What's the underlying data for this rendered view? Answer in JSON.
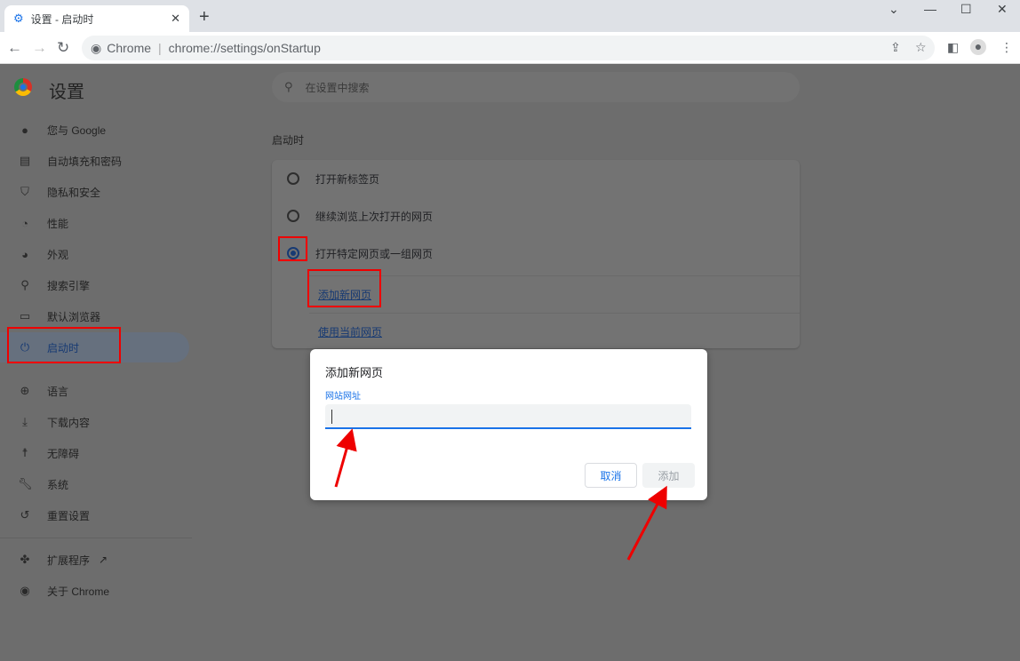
{
  "browser": {
    "tab_title": "设置 - 启动时",
    "omnibox_label": "Chrome",
    "url": "chrome://settings/onStartup"
  },
  "header": {
    "title": "设置",
    "search_placeholder": "在设置中搜索"
  },
  "sidebar": {
    "items": [
      {
        "label": "您与 Google",
        "icon": "person-icon"
      },
      {
        "label": "自动填充和密码",
        "icon": "clipboard-icon"
      },
      {
        "label": "隐私和安全",
        "icon": "shield-icon"
      },
      {
        "label": "性能",
        "icon": "speedometer-icon"
      },
      {
        "label": "外观",
        "icon": "palette-icon"
      },
      {
        "label": "搜索引擎",
        "icon": "search-icon"
      },
      {
        "label": "默认浏览器",
        "icon": "browser-icon"
      },
      {
        "label": "启动时",
        "icon": "power-icon",
        "active": true
      },
      {
        "label": "语言",
        "icon": "globe-icon"
      },
      {
        "label": "下载内容",
        "icon": "download-icon"
      },
      {
        "label": "无障碍",
        "icon": "accessibility-icon"
      },
      {
        "label": "系统",
        "icon": "wrench-icon"
      },
      {
        "label": "重置设置",
        "icon": "reset-icon"
      },
      {
        "label": "扩展程序",
        "icon": "puzzle-icon"
      },
      {
        "label": "关于 Chrome",
        "icon": "chrome-icon"
      }
    ]
  },
  "main": {
    "section_title": "启动时",
    "options": [
      {
        "label": "打开新标签页",
        "selected": false
      },
      {
        "label": "继续浏览上次打开的网页",
        "selected": false
      },
      {
        "label": "打开特定网页或一组网页",
        "selected": true
      }
    ],
    "add_page_link": "添加新网页",
    "use_current_link": "使用当前网页"
  },
  "dialog": {
    "title": "添加新网页",
    "field_label": "网站网址",
    "field_value": "",
    "cancel": "取消",
    "add": "添加"
  },
  "colors": {
    "accent": "#1a73e8",
    "annotation": "#e00000"
  }
}
